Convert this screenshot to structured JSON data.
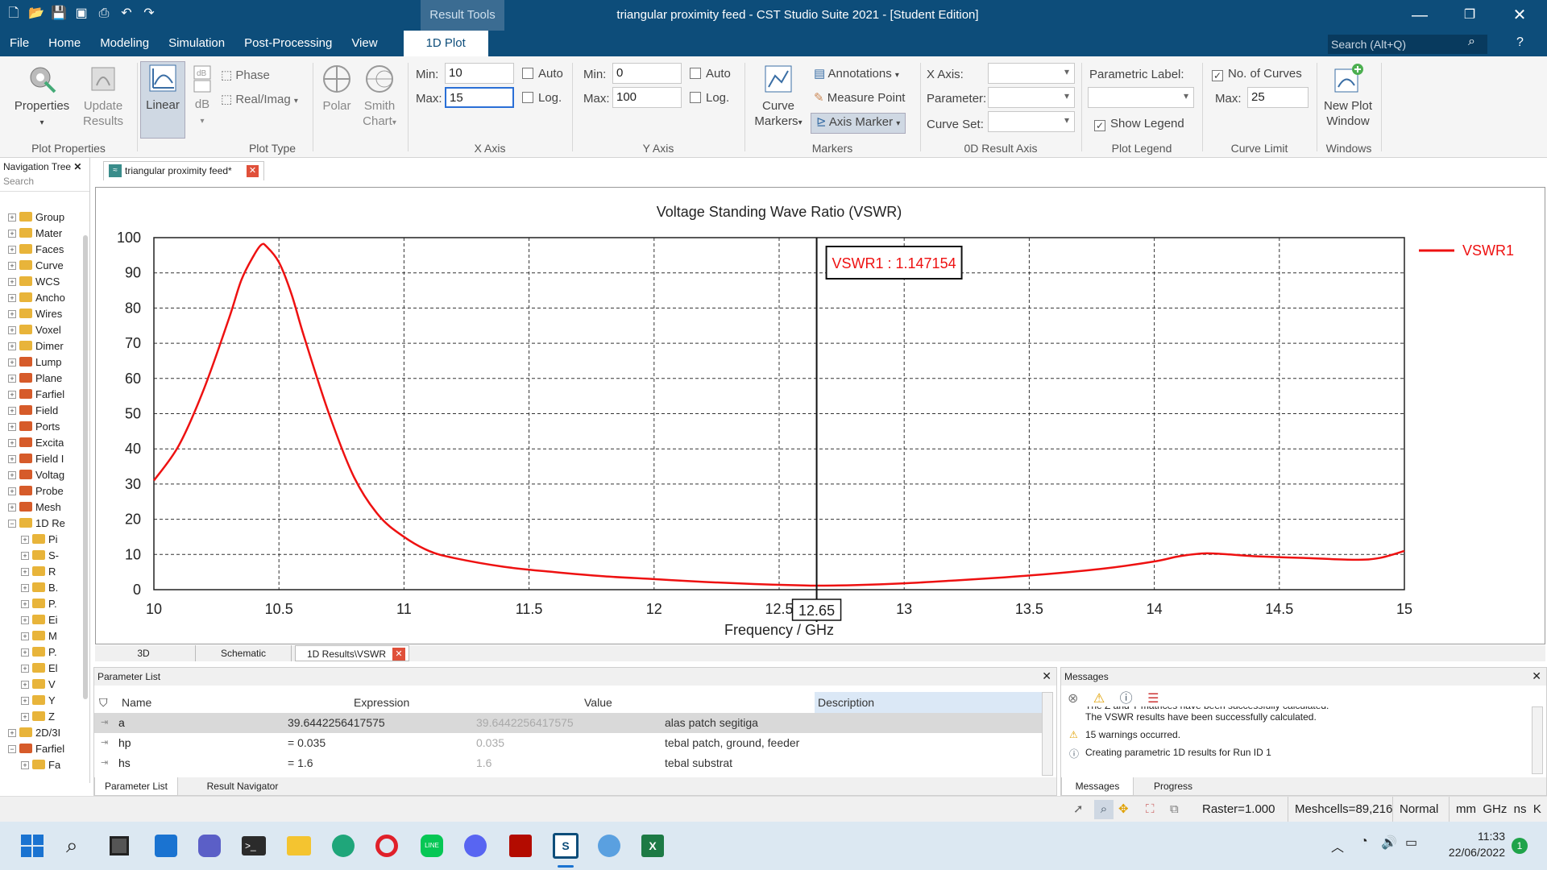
{
  "window": {
    "title": "triangular proximity feed - CST Studio Suite 2021 - [Student Edition]",
    "context_tab_group": "Result Tools"
  },
  "menu": [
    "File",
    "Home",
    "Modeling",
    "Simulation",
    "Post-Processing",
    "View",
    "1D Plot"
  ],
  "search": {
    "placeholder": "Search (Alt+Q)"
  },
  "ribbon": {
    "properties": "Properties",
    "update_results": "Update Results",
    "plot_properties_group": "Plot Properties",
    "linear": "Linear",
    "db": "dB",
    "phase": "Phase",
    "real_imag": "Real/Imag",
    "polar": "Polar",
    "smith_chart": "Smith Chart",
    "plot_type_group": "Plot Type",
    "x_axis_group": "X Axis",
    "x_min_label": "Min:",
    "x_min": "10",
    "x_max_label": "Max:",
    "x_max": "15",
    "x_auto": "Auto",
    "x_log": "Log.",
    "y_axis_group": "Y Axis",
    "y_min_label": "Min:",
    "y_min": "0",
    "y_max_label": "Max:",
    "y_max": "100",
    "y_auto": "Auto",
    "y_log": "Log.",
    "curve_markers": "Curve Markers",
    "annotations": "Annotations",
    "measure_point": "Measure Point",
    "axis_marker": "Axis Marker",
    "markers_group": "Markers",
    "x_axis_label": "X Axis:",
    "parameter_label": "Parameter:",
    "curve_set_label": "Curve Set:",
    "od_group": "0D Result Axis",
    "parametric_label": "Parametric Label:",
    "show_legend": "Show Legend",
    "plot_legend_group": "Plot Legend",
    "no_of_curves": "No. of Curves",
    "curve_max_label": "Max:",
    "curve_max": "25",
    "curve_limit_group": "Curve Limit",
    "new_plot_window": "New Plot Window",
    "windows_group": "Windows"
  },
  "nav": {
    "title": "Navigation Tree",
    "search_placeholder": "Search",
    "items": [
      "Group",
      "Mater",
      "Faces",
      "Curve",
      "WCS",
      "Ancho",
      "Wires",
      "Voxel",
      "Dimer",
      "Lump",
      "Plane",
      "Farfiel",
      "Field",
      "Ports",
      "Excita",
      "Field I",
      "Voltag",
      "Probe",
      "Mesh",
      "1D Re",
      "Pi",
      "S-",
      "R",
      "B.",
      "P.",
      "Ei",
      "M",
      "P.",
      "El",
      "V",
      "Y",
      "Z",
      "2D/3I",
      "Farfiel",
      "Fa"
    ]
  },
  "doc_tab": "triangular proximity feed*",
  "chart_data": {
    "type": "line",
    "title": "Voltage Standing Wave Ratio (VSWR)",
    "xlabel": "Frequency / GHz",
    "ylabel": "",
    "xlim": [
      10,
      15
    ],
    "ylim": [
      0,
      100
    ],
    "x_ticks": [
      "10",
      "10.5",
      "11",
      "11.5",
      "12",
      "12.5",
      "13",
      "13.5",
      "14",
      "14.5",
      "15"
    ],
    "y_ticks": [
      "0",
      "10",
      "20",
      "30",
      "40",
      "50",
      "60",
      "70",
      "80",
      "90",
      "100"
    ],
    "grid": true,
    "legend": "right",
    "series": [
      {
        "name": "VSWR1",
        "color": "#ee1111",
        "x": [
          10.0,
          10.1,
          10.2,
          10.3,
          10.35,
          10.4,
          10.43,
          10.45,
          10.5,
          10.55,
          10.6,
          10.7,
          10.8,
          10.9,
          11.0,
          11.1,
          11.2,
          11.4,
          11.6,
          11.8,
          12.0,
          12.2,
          12.4,
          12.6,
          12.65,
          12.8,
          13.0,
          13.2,
          13.4,
          13.6,
          13.8,
          14.0,
          14.1,
          14.2,
          14.3,
          14.4,
          14.6,
          14.8,
          14.9,
          15.0
        ],
        "y": [
          31,
          41,
          57,
          77,
          88,
          95,
          98,
          97.5,
          93,
          84,
          72,
          50,
          32,
          21,
          15,
          11,
          9,
          6.5,
          5,
          3.8,
          3,
          2.2,
          1.6,
          1.2,
          1.147,
          1.3,
          1.8,
          2.6,
          3.5,
          4.6,
          6,
          8,
          9.5,
          10.3,
          10,
          9.5,
          9,
          8.5,
          9,
          11
        ]
      }
    ],
    "marker": {
      "x_label": "12.65",
      "annotation": "VSWR1 : 1.147154",
      "x": 12.65
    }
  },
  "bottom_tabs": [
    "3D",
    "Schematic",
    "1D Results\\VSWR"
  ],
  "param_list": {
    "title": "Parameter List",
    "headers": [
      "Name",
      "Expression",
      "Value",
      "Description"
    ],
    "rows": [
      {
        "name": "a",
        "expr": "39.6442256417575",
        "value": "39.6442256417575",
        "desc": "alas patch segitiga"
      },
      {
        "name": "hp",
        "expr": "= 0.035",
        "value": "0.035",
        "desc": "tebal patch, ground, feeder"
      },
      {
        "name": "hs",
        "expr": "= 1.6",
        "value": "1.6",
        "desc": "tebal substrat"
      }
    ],
    "tabs": [
      "Parameter List",
      "Result Navigator"
    ]
  },
  "messages": {
    "title": "Messages",
    "lines": [
      "The Z and Y matrices have been successfully calculated.",
      "The VSWR results have been successfully calculated.",
      "15 warnings occurred.",
      "Creating parametric 1D results for Run ID 1"
    ],
    "tabs": [
      "Messages",
      "Progress"
    ]
  },
  "status": {
    "raster": "Raster=1.000",
    "meshcells": "Meshcells=89,216",
    "mode": "Normal",
    "units": "mm  GHz  ns  K"
  },
  "taskbar": {
    "time": "11:33",
    "date": "22/06/2022",
    "badge": "1"
  }
}
